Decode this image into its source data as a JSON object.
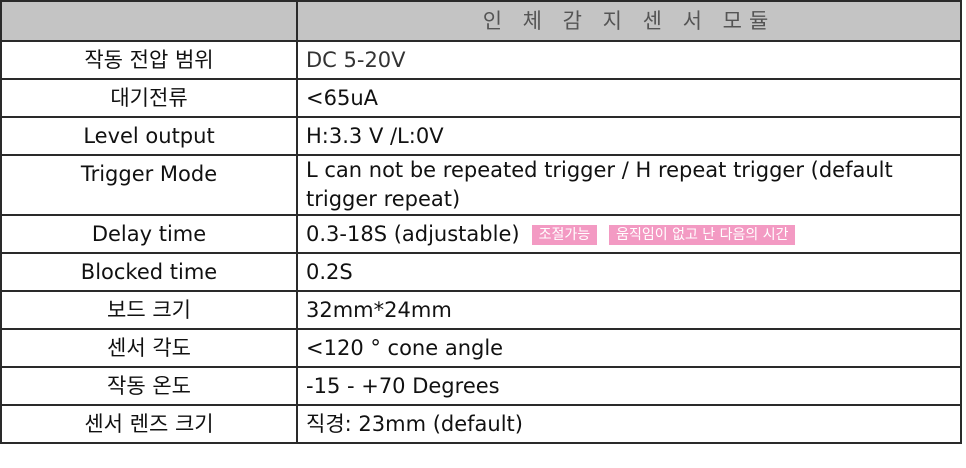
{
  "header": {
    "left": "",
    "title": "인 체 감 지 센 서 모듈"
  },
  "rows": [
    {
      "key": "작동 전압 범위",
      "value": "DC 5-20V"
    },
    {
      "key": "대기전류",
      "value": "<65uA"
    },
    {
      "key": "Level output",
      "value": "H:3.3 V /L:0V"
    },
    {
      "key": "Trigger Mode",
      "value": " L can not be repeated trigger / H repeat trigger (default trigger repeat)"
    },
    {
      "key": "Delay time",
      "value": " 0.3-18S (adjustable)"
    },
    {
      "key": "Blocked time",
      "value": " 0.2S"
    },
    {
      "key": "보드 크기",
      "value": "32mm*24mm"
    },
    {
      "key": "센서 각도",
      "value": "<120 ° cone angle"
    },
    {
      "key": "작동 온도",
      "value": "-15 - +70 Degrees"
    },
    {
      "key": "센서 렌즈 크기",
      "value": "직경: 23mm (default)"
    }
  ],
  "annotations": {
    "adjustable_tag": "조절가능",
    "delay_tag": "움직임이 없고 난 다음의 시간",
    "tag_color": "#f39ac3"
  }
}
